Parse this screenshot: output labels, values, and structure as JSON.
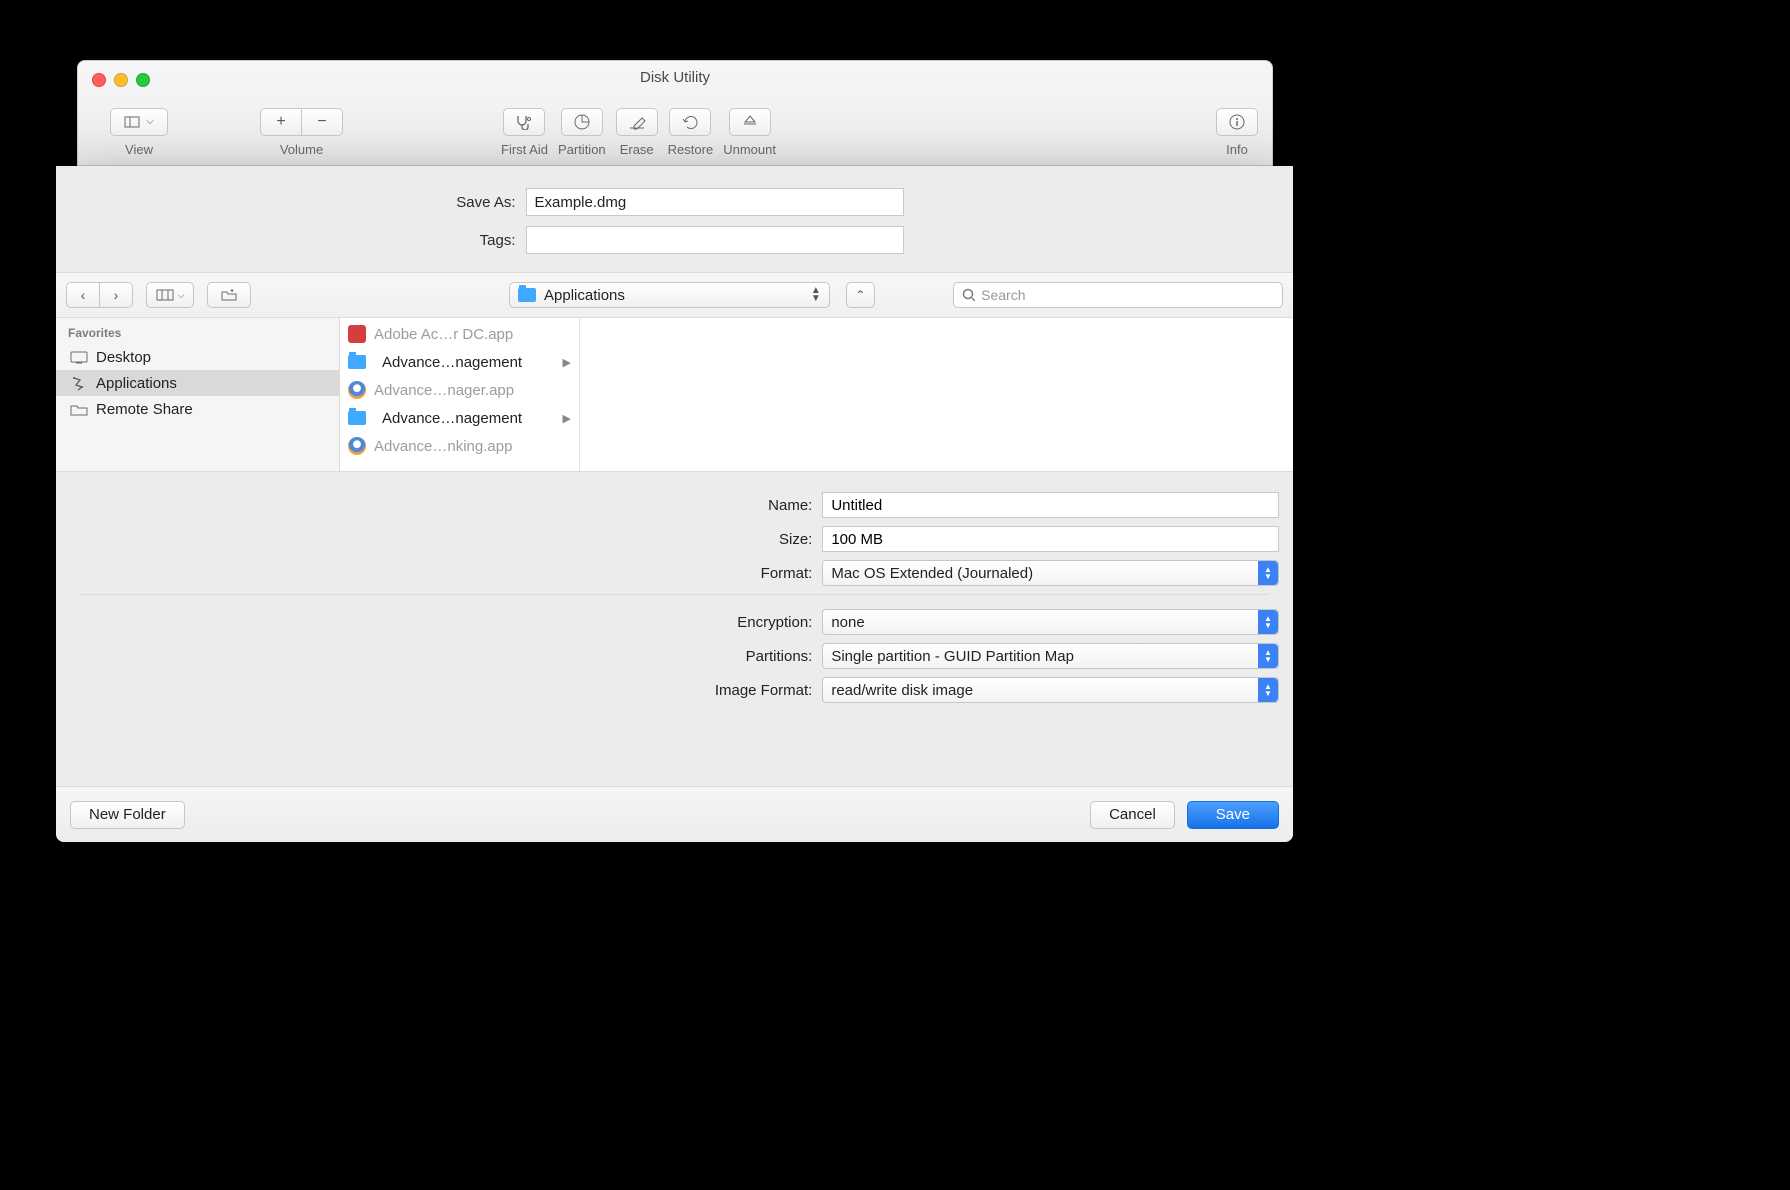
{
  "window": {
    "title": "Disk Utility",
    "toolbar": {
      "view": "View",
      "volume": "Volume",
      "first_aid": "First Aid",
      "partition": "Partition",
      "erase": "Erase",
      "restore": "Restore",
      "unmount": "Unmount",
      "info": "Info"
    }
  },
  "sheet": {
    "save_as_label": "Save As:",
    "save_as_value": "Example.dmg",
    "tags_label": "Tags:",
    "tags_value": "",
    "location": "Applications",
    "search_placeholder": "Search"
  },
  "sidebar": {
    "heading": "Favorites",
    "items": [
      {
        "label": "Desktop",
        "icon": "desktop"
      },
      {
        "label": "Applications",
        "icon": "apps",
        "selected": true
      },
      {
        "label": "Remote Share",
        "icon": "folder"
      }
    ]
  },
  "filelist": [
    {
      "label": "Adobe Ac…r DC.app",
      "icon": "red",
      "dim": true
    },
    {
      "label": "Advance…nagement",
      "icon": "folder",
      "arrow": true
    },
    {
      "label": "Advance…nager.app",
      "icon": "ff",
      "dim": true
    },
    {
      "label": "Advance…nagement",
      "icon": "folder",
      "arrow": true
    },
    {
      "label": "Advance…nking.app",
      "icon": "ff",
      "dim": true
    }
  ],
  "options": {
    "name_label": "Name:",
    "name_value": "Untitled",
    "size_label": "Size:",
    "size_value": "100 MB",
    "format_label": "Format:",
    "format_value": "Mac OS Extended (Journaled)",
    "encryption_label": "Encryption:",
    "encryption_value": "none",
    "partitions_label": "Partitions:",
    "partitions_value": "Single partition - GUID Partition Map",
    "imgfmt_label": "Image Format:",
    "imgfmt_value": "read/write disk image"
  },
  "footer": {
    "new_folder": "New Folder",
    "cancel": "Cancel",
    "save": "Save"
  }
}
